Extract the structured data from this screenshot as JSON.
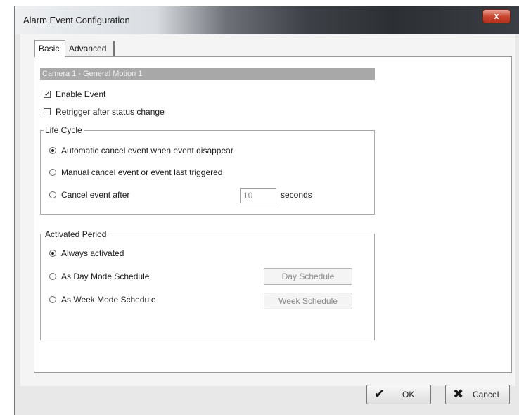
{
  "window": {
    "title": "Alarm Event Configuration",
    "close_glyph": "x"
  },
  "tabs": [
    {
      "label": "Basic",
      "active": true
    },
    {
      "label": "Advanced",
      "active": false
    }
  ],
  "camera_header": "Camera 1 - General Motion 1",
  "enable_event": {
    "label": "Enable Event",
    "checked": true,
    "mark": "✓"
  },
  "retrigger": {
    "label": "Retrigger after status change",
    "checked": false
  },
  "life_cycle": {
    "legend": "Life Cycle",
    "options": [
      {
        "label": "Automatic cancel event when event disappear",
        "selected": true
      },
      {
        "label": "Manual cancel event or event last triggered",
        "selected": false
      },
      {
        "label": "Cancel event after",
        "selected": false
      }
    ],
    "seconds_value": "10",
    "seconds_label": "seconds"
  },
  "activated_period": {
    "legend": "Activated Period",
    "options": [
      {
        "label": "Always activated",
        "selected": true
      },
      {
        "label": "As Day Mode Schedule",
        "selected": false
      },
      {
        "label": "As Week Mode Schedule",
        "selected": false
      }
    ],
    "day_schedule_label": "Day Schedule",
    "week_schedule_label": "Week Schedule"
  },
  "footer": {
    "ok_label": "OK",
    "ok_icon": "✔",
    "cancel_label": "Cancel",
    "cancel_icon": "✖"
  }
}
